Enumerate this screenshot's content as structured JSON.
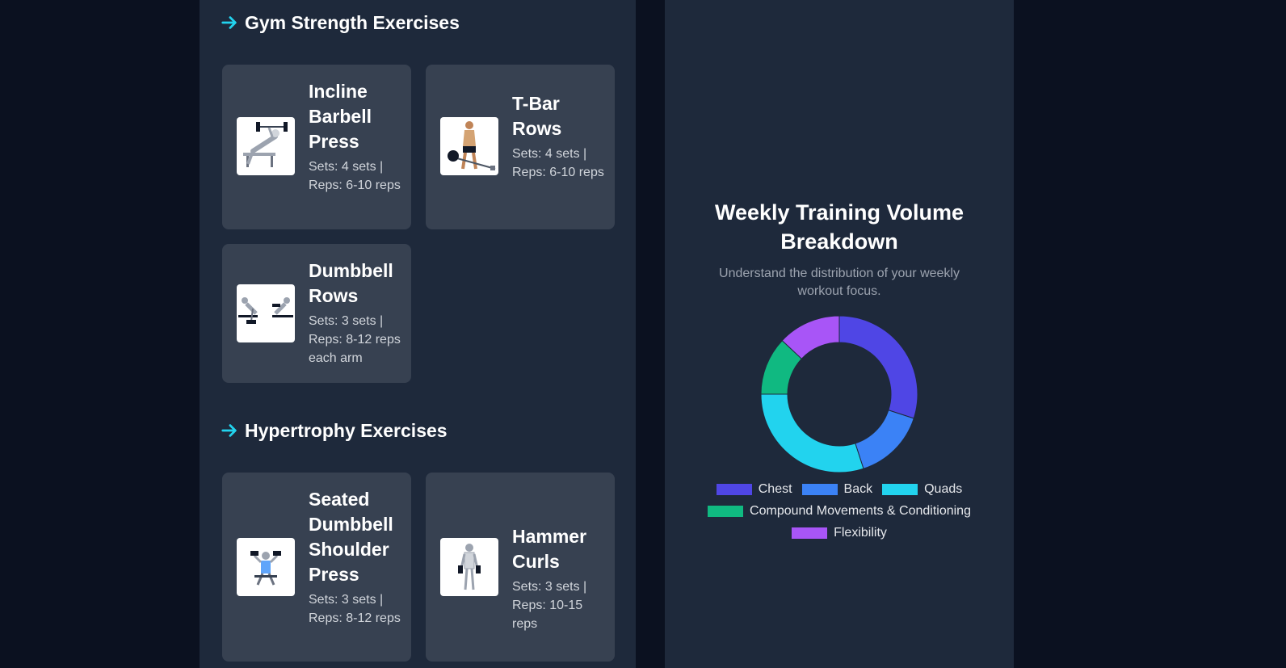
{
  "sections": {
    "gym": {
      "title": "Gym Strength Exercises",
      "cards": [
        {
          "name": "Incline Barbell Press",
          "detail": "Sets: 4 sets | Reps: 6-10 reps"
        },
        {
          "name": "T-Bar Rows",
          "detail": "Sets: 4 sets | Reps: 6-10 reps"
        },
        {
          "name": "Dumbbell Rows",
          "detail": "Sets: 3 sets | Reps: 8-12 reps each arm"
        }
      ]
    },
    "hypertrophy": {
      "title": "Hypertrophy Exercises",
      "cards": [
        {
          "name": "Seated Dumbbell Shoulder Press",
          "detail": "Sets: 3 sets | Reps: 8-12 reps"
        },
        {
          "name": "Hammer Curls",
          "detail": "Sets: 3 sets | Reps: 10-15 reps"
        }
      ]
    }
  },
  "chart_panel": {
    "title": "Weekly Training Volume Breakdown",
    "subtitle": "Understand the distribution of your weekly workout focus."
  },
  "chart_data": {
    "type": "pie",
    "title": "Weekly Training Volume Breakdown",
    "categories": [
      "Chest",
      "Back",
      "Quads",
      "Compound Movements & Conditioning",
      "Flexibility"
    ],
    "values": [
      30,
      15,
      30,
      12,
      13
    ],
    "colors": [
      "#4f46e5",
      "#3b82f6",
      "#22d3ee",
      "#10b981",
      "#a855f7"
    ],
    "legend": "bottom"
  },
  "colors": {
    "accent": "#22d3ee",
    "panel": "#1e293b",
    "card": "#374151",
    "background": "#0b1120"
  }
}
